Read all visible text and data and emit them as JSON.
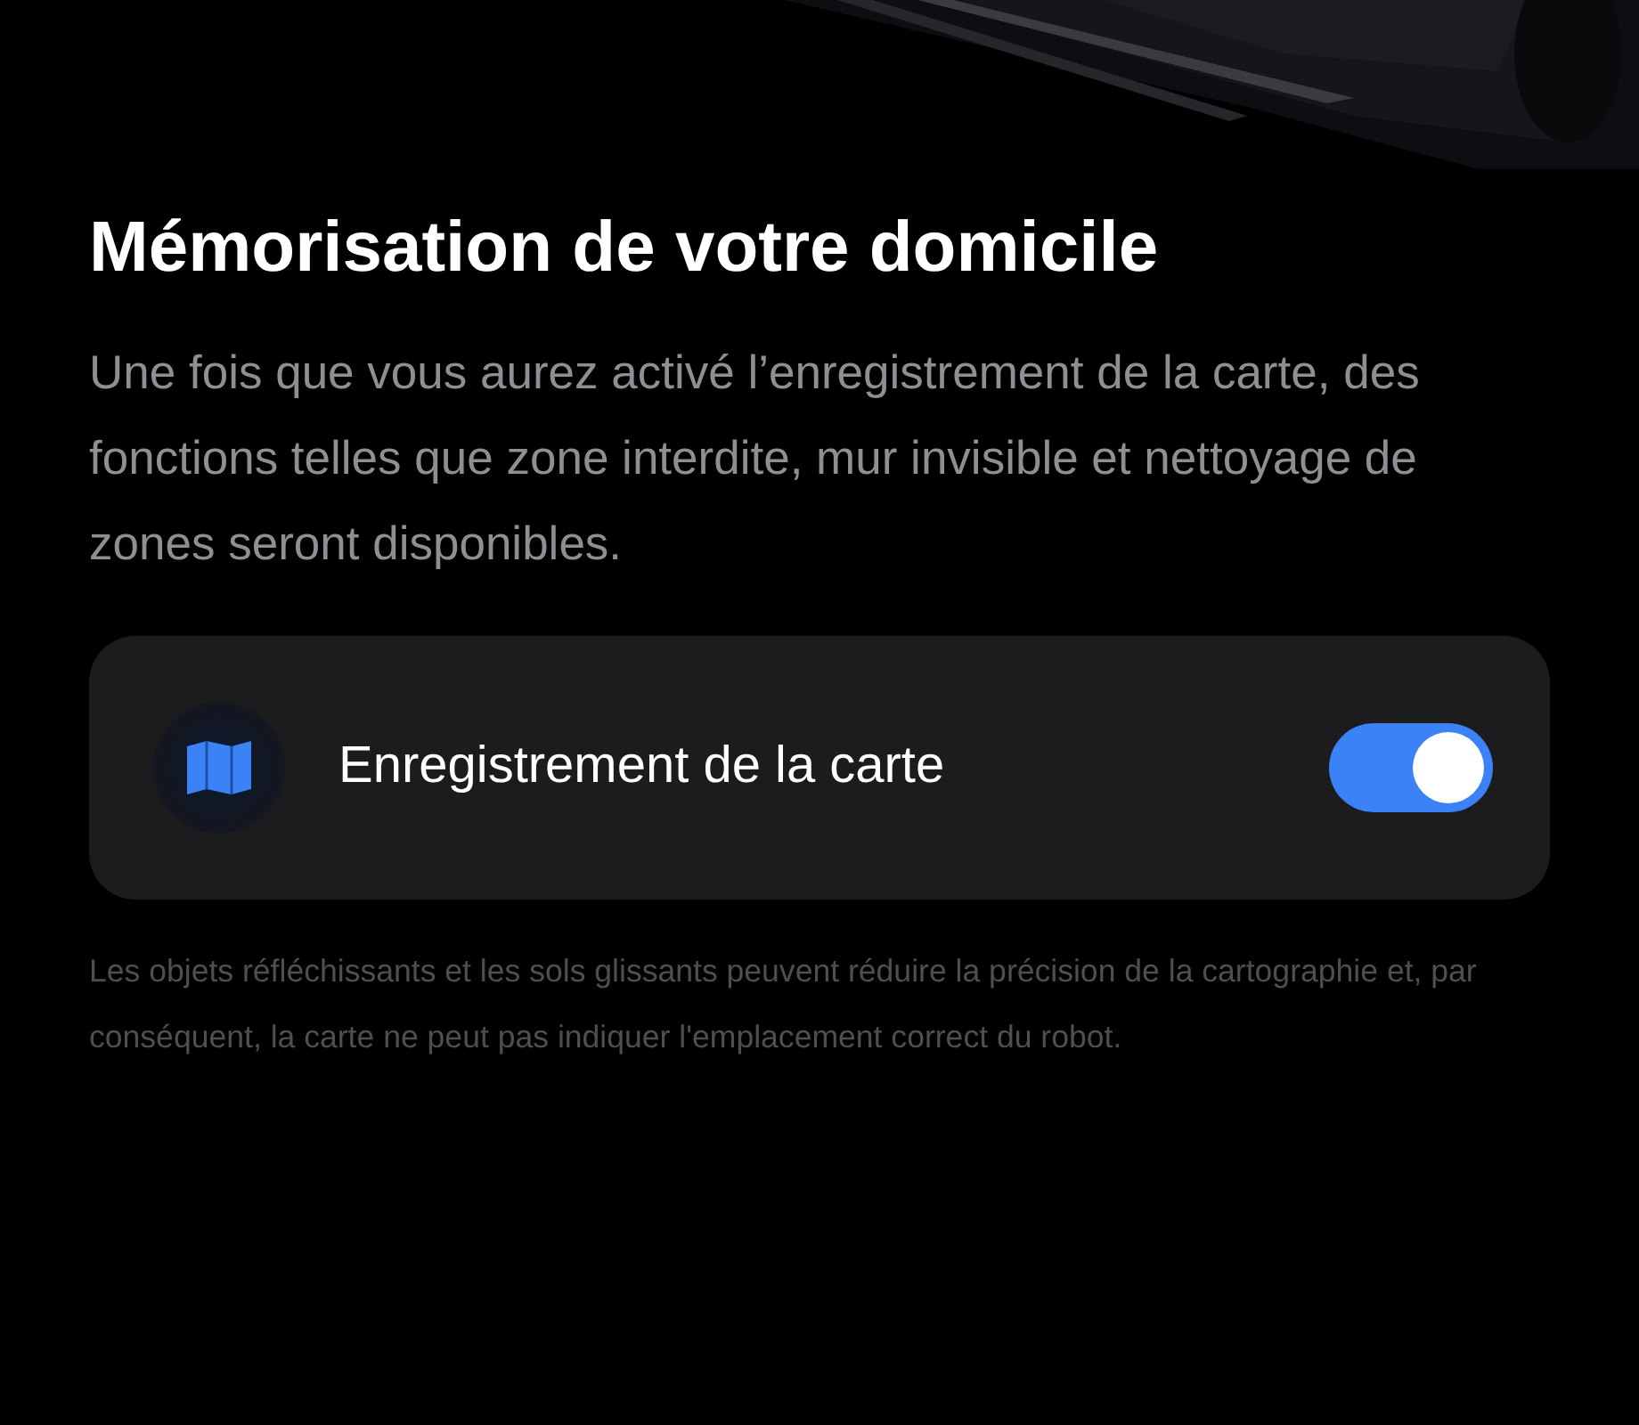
{
  "title": "Mémorisation de votre domicile",
  "description": "Une fois que vous aurez activé l’enregistrement de la carte, des fonctions telles que zone interdite, mur invisible et nettoyage de zones seront disponibles.",
  "setting": {
    "label": "Enregistrement de la carte",
    "on": true
  },
  "note": "Les objets réfléchissants et les sols glissants peuvent réduire la précision de la cartographie et, par conséquent, la carte ne peut pas indiquer l'emplacement correct du robot."
}
